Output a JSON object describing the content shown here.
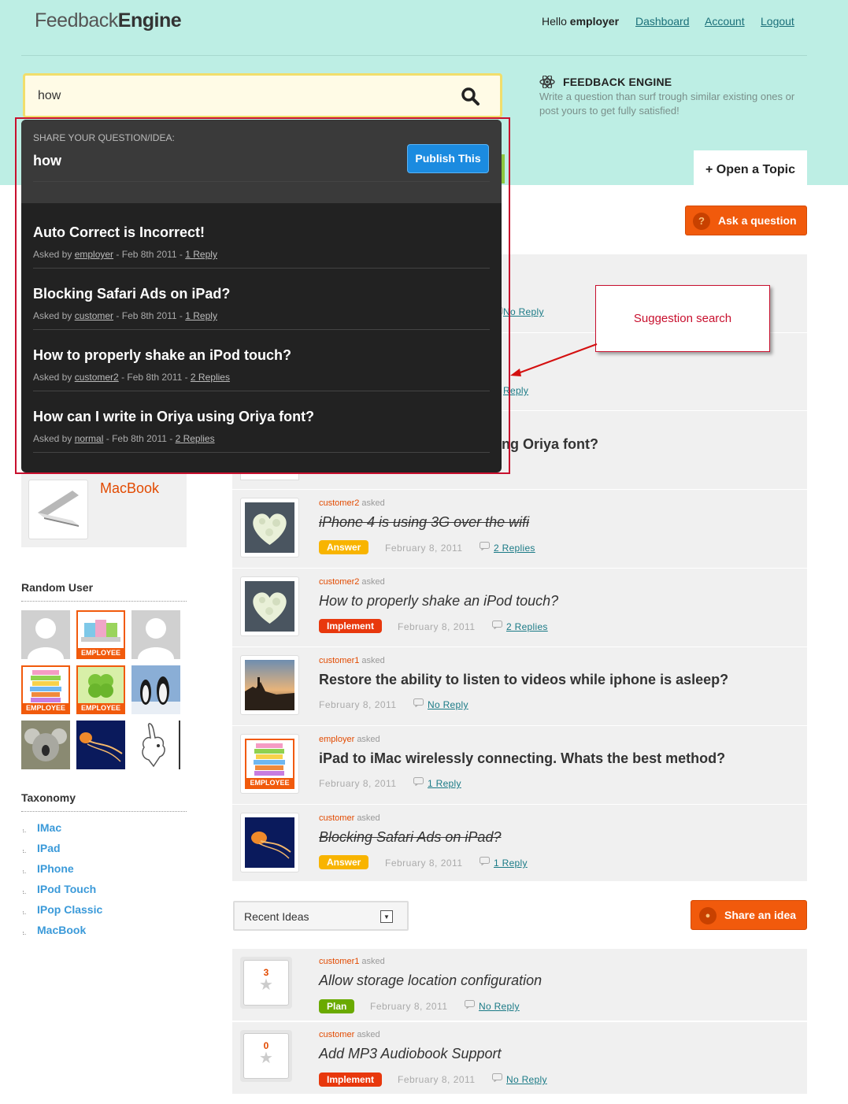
{
  "header": {
    "logo_light": "Feedback",
    "logo_bold": "Engine",
    "greeting_prefix": "Hello",
    "username": "employer",
    "nav": [
      "Dashboard",
      "Account",
      "Logout"
    ],
    "fe_title": "FEEDBACK ENGINE",
    "fe_desc": "Write a question than surf trough similar existing ones or post yours to get fully satisfied!",
    "open_topic": "+ Open a Topic"
  },
  "search": {
    "value": "how"
  },
  "popup": {
    "label": "SHARE YOUR QUESTION/IDEA:",
    "question": "how",
    "publish_label": "Publish This",
    "suggestions": [
      {
        "title": "Auto Correct is Incorrect!",
        "asked_by": "Asked by",
        "user": "employer",
        "date": "- Feb 8th 2011 -",
        "replies": "1 Reply"
      },
      {
        "title": "Blocking Safari Ads on iPad?",
        "asked_by": "Asked by",
        "user": "customer",
        "date": "- Feb 8th 2011 -",
        "replies": "1 Reply"
      },
      {
        "title": "How to properly shake an iPod touch?",
        "asked_by": "Asked by",
        "user": "customer2",
        "date": "- Feb 8th 2011 -",
        "replies": "2 Replies"
      },
      {
        "title": "How can I write in Oriya using Oriya font?",
        "asked_by": "Asked by",
        "user": "normal",
        "date": "- Feb 8th 2011 -",
        "replies": "2 Replies"
      }
    ]
  },
  "callout": {
    "text": "Suggestion search"
  },
  "ask_button": "Ask a question",
  "partial": {
    "no_reply": "No Reply",
    "reply_fragment": "Reply",
    "oriya_fragment": "ing Oriya font?"
  },
  "questions": [
    {
      "user": "customer2",
      "asked": "asked",
      "title": "iPhone 4 is using 3G over the wifi",
      "badge": "Answer",
      "date": "February 8, 2011",
      "replies": "2 Replies"
    },
    {
      "user": "customer2",
      "asked": "asked",
      "title": "How to properly shake an iPod touch?",
      "badge": "Implement",
      "date": "February 8, 2011",
      "replies": "2 Replies"
    },
    {
      "user": "customer1",
      "asked": "asked",
      "title": "Restore the ability to listen to videos while iphone is asleep?",
      "badge": "",
      "date": "February 8, 2011",
      "replies": "No Reply"
    },
    {
      "user": "employer",
      "asked": "asked",
      "title": "iPad to iMac wirelessly connecting. Whats the best method?",
      "badge": "",
      "date": "February 8, 2011",
      "replies": "1 Reply"
    },
    {
      "user": "customer",
      "asked": "asked",
      "title": "Blocking Safari Ads on iPad?",
      "badge": "Answer",
      "date": "February 8, 2011",
      "replies": "1 Reply"
    }
  ],
  "sidebar": {
    "macbook_label": "MacBook",
    "random_user_title": "Random User",
    "employee_tag": "EMPLOYEE",
    "taxonomy_title": "Taxonomy",
    "taxonomy": [
      "IMac",
      "IPad",
      "IPhone",
      "IPod Touch",
      "IPop Classic",
      "MacBook"
    ]
  },
  "ideas": {
    "dropdown_value": "Recent Ideas",
    "share_button": "Share an idea",
    "items": [
      {
        "votes": "3",
        "user": "customer1",
        "asked": "asked",
        "title": "Allow storage location configuration",
        "badge": "Plan",
        "date": "February 8, 2011",
        "replies": "No Reply"
      },
      {
        "votes": "0",
        "user": "customer",
        "asked": "asked",
        "title": "Add MP3 Audiobook Support",
        "badge": "Implement",
        "date": "February 8, 2011",
        "replies": "No Reply"
      }
    ]
  },
  "colors": {
    "header_bg": "#bdeee4",
    "accent_orange": "#f15a0c",
    "answer_badge": "#f8b400",
    "implement_badge": "#e8380d",
    "plan_badge": "#6aaa00",
    "link_teal": "#1a7a86",
    "callout_red": "#c8102e"
  }
}
